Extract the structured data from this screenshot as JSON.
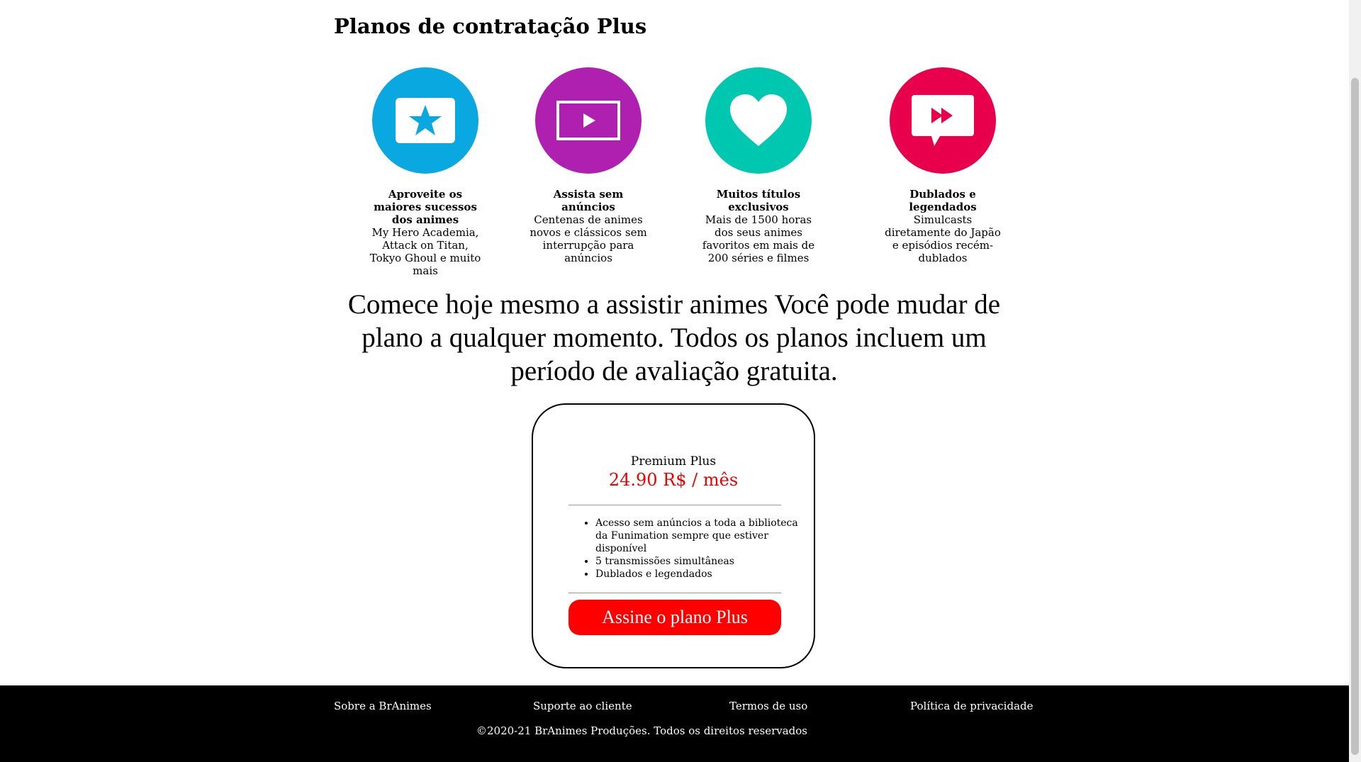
{
  "page": {
    "title": "Planos de contratação Plus"
  },
  "colors": {
    "feature_1": "#0aa8e0",
    "feature_2": "#b020b0",
    "feature_3": "#00c8b0",
    "feature_4": "#e8004c",
    "price": "#f00000",
    "button": "#ff0000",
    "footer_bg": "#000000"
  },
  "features": [
    {
      "icon": "star-screen-icon",
      "title": "Aproveite os maiores sucessos dos animes",
      "description": "My Hero Academia, Attack on Titan, Tokyo Ghoul e muito mais"
    },
    {
      "icon": "play-screen-icon",
      "title": "Assista sem anúncios",
      "description": "Centenas de animes novos e clássicos sem interrupção para anúncios"
    },
    {
      "icon": "heart-icon",
      "title": "Muitos títulos exclusivos",
      "description": "Mais de 1500 horas dos seus animes favoritos em mais de 200 séries e filmes"
    },
    {
      "icon": "fast-forward-bubble-icon",
      "title": "Dublados e legendados",
      "description": "Simulcasts diretamente do Japão e episódios recém-dublados"
    }
  ],
  "cta": "Comece hoje mesmo a assistir animes Você pode mudar de plano a qualquer momento. Todos os planos incluem um período de avaliação gratuita.",
  "plan": {
    "name": "Premium Plus",
    "price": "24.90 R$ / mês",
    "benefits": [
      "Acesso sem anúncios a toda a biblioteca da Funimation sempre que estiver disponível",
      "5 transmissões simultâneas",
      "Dublados e legendados"
    ],
    "button_label": "Assine o plano Plus"
  },
  "footer": {
    "links": [
      "Sobre a BrAnimes",
      "Suporte ao cliente",
      "Termos de uso",
      "Política de privacidade"
    ],
    "copyright": "©2020-21 BrAnimes Produções. Todos os direitos reservados"
  }
}
